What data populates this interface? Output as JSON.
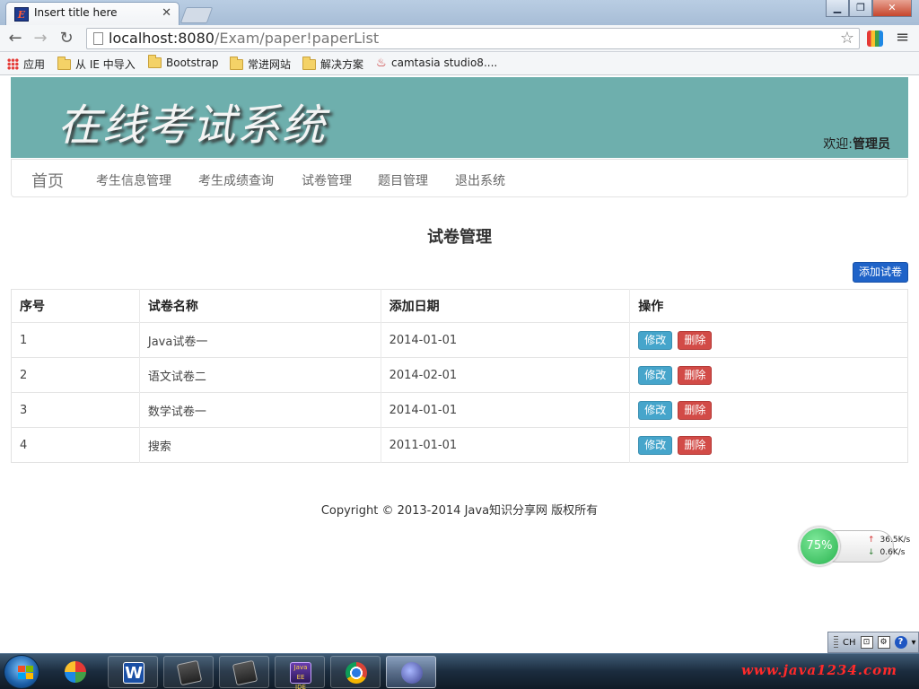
{
  "browser": {
    "tab_title": "Insert title here",
    "url_host": "localhost:8080",
    "url_path": "/Exam/paper!paperList",
    "bookmarks": [
      {
        "label": "应用",
        "icon": "apps-icon"
      },
      {
        "label": "从 IE 中导入",
        "icon": "folder-icon"
      },
      {
        "label": "Bootstrap",
        "icon": "folder-icon"
      },
      {
        "label": "常进网站",
        "icon": "folder-icon"
      },
      {
        "label": "解决方案",
        "icon": "folder-icon"
      },
      {
        "label": "camtasia studio8....",
        "icon": "camtasia-icon"
      }
    ]
  },
  "header": {
    "logo": "在线考试系统",
    "welcome_prefix": "欢迎:",
    "welcome_user": "管理员",
    "bg_color": "#6eafad"
  },
  "nav": {
    "brand": "首页",
    "items": [
      "考生信息管理",
      "考生成绩查询",
      "试卷管理",
      "题目管理",
      "退出系统"
    ]
  },
  "main": {
    "title": "试卷管理",
    "add_button": "添加试卷",
    "columns": [
      "序号",
      "试卷名称",
      "添加日期",
      "操作"
    ],
    "rows": [
      {
        "id": "1",
        "name": "Java试卷一",
        "date": "2014-01-01"
      },
      {
        "id": "2",
        "name": "语文试卷二",
        "date": "2014-02-01"
      },
      {
        "id": "3",
        "name": "数学试卷一",
        "date": "2014-01-01"
      },
      {
        "id": "4",
        "name": "搜索",
        "date": "2011-01-01"
      }
    ],
    "edit_label": "修改",
    "delete_label": "删除"
  },
  "footer": {
    "copyright": "Copyright © 2013-2014 Java知识分享网 版权所有"
  },
  "speed_widget": {
    "percent": "75%",
    "up": "36.5K/s",
    "down": "0.6K/s"
  },
  "langbar": {
    "lang": "CH"
  },
  "taskbar": {
    "tray_text": "www.java1234.com"
  }
}
